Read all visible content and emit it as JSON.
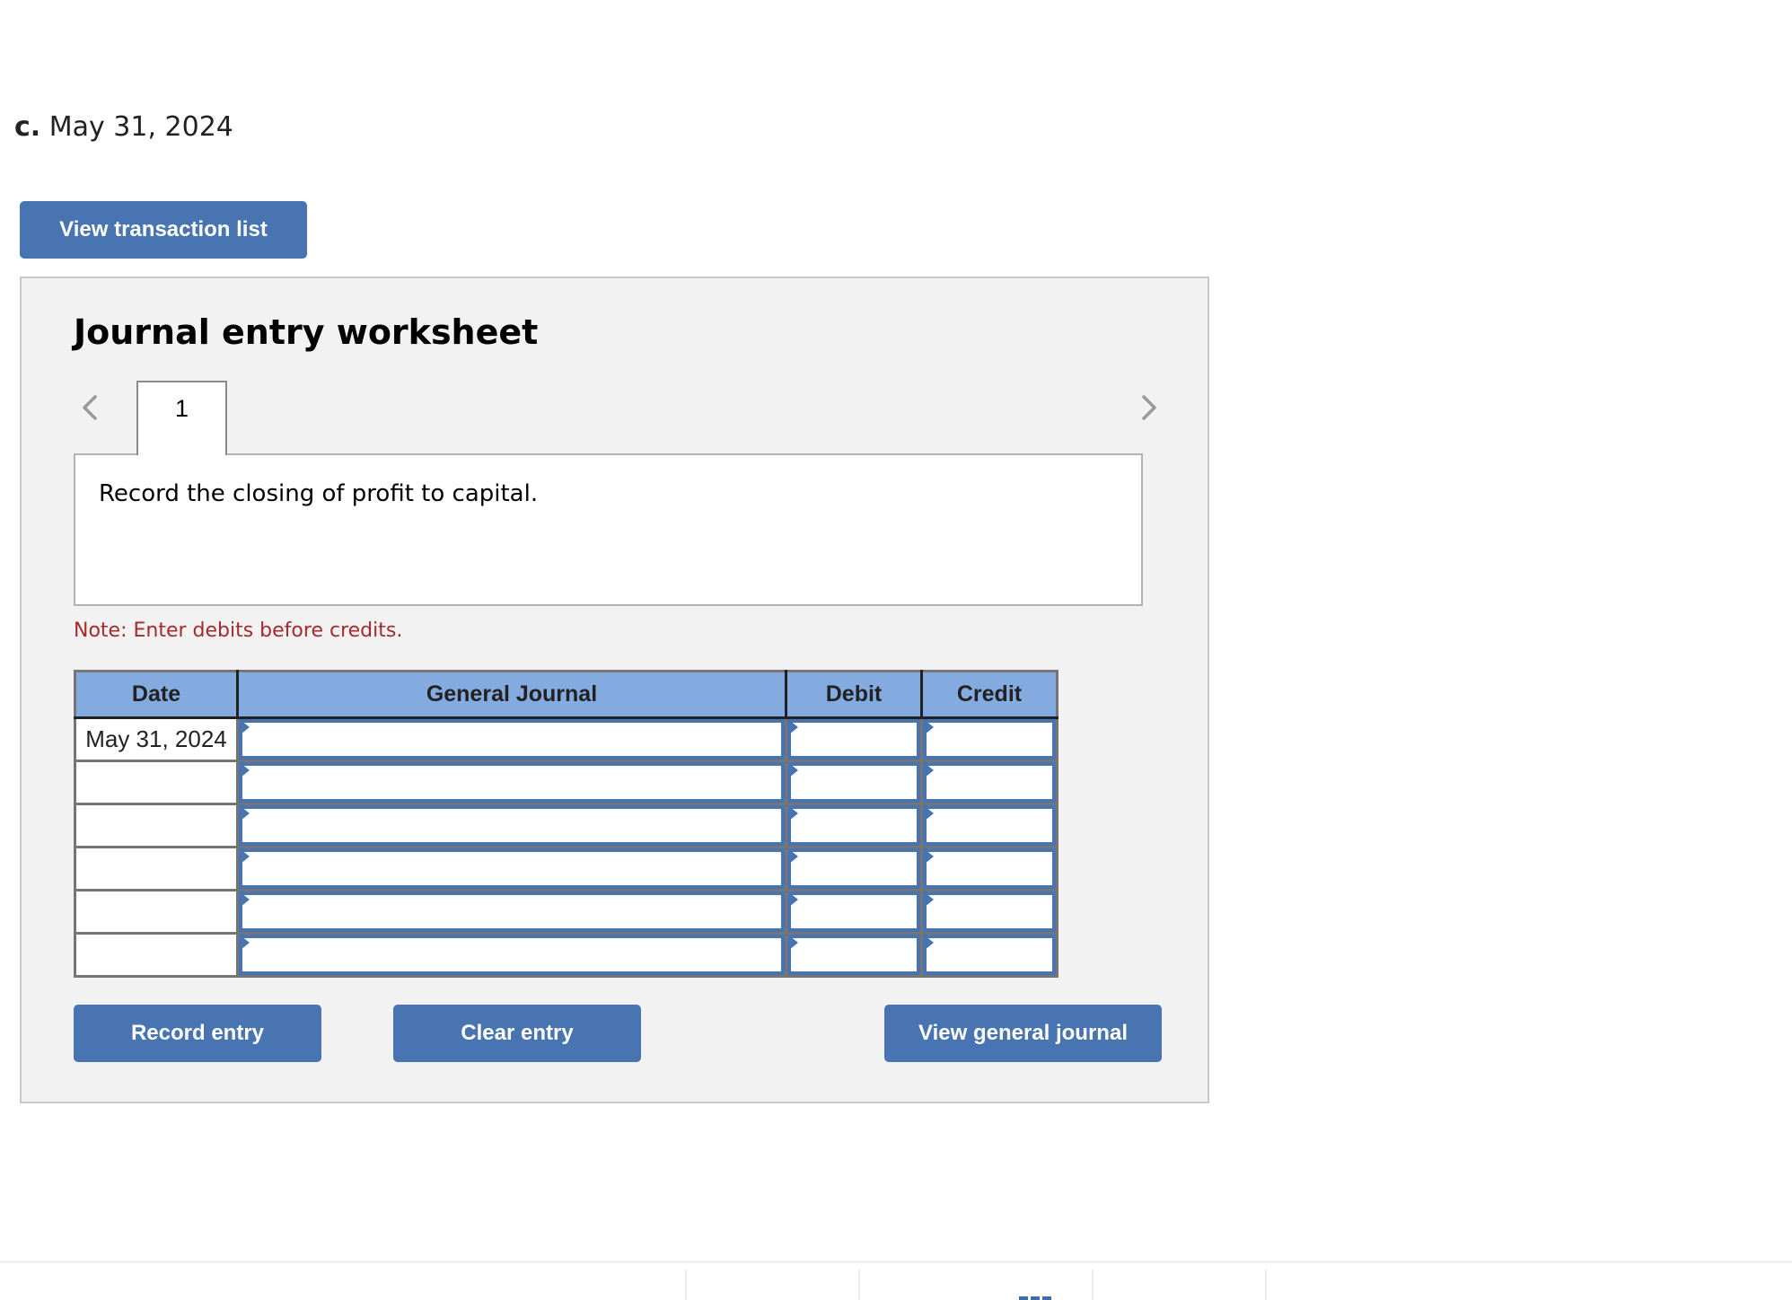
{
  "part": {
    "letter": "c.",
    "date": "May 31, 2024"
  },
  "buttons": {
    "view_transactions": "View transaction list",
    "record_entry": "Record entry",
    "clear_entry": "Clear entry",
    "view_general_journal": "View general journal"
  },
  "worksheet": {
    "title": "Journal entry worksheet",
    "tabs": [
      {
        "label": "1",
        "active": true
      }
    ],
    "nav": {
      "prev_icon": "chevron-left-icon",
      "next_icon": "chevron-right-icon"
    },
    "description": "Record the closing of profit to capital.",
    "note": "Note: Enter debits before credits."
  },
  "journal": {
    "columns": [
      "Date",
      "General Journal",
      "Debit",
      "Credit"
    ],
    "rows": [
      {
        "date": "May 31, 2024",
        "account": "",
        "debit": "",
        "credit": ""
      },
      {
        "date": "",
        "account": "",
        "debit": "",
        "credit": ""
      },
      {
        "date": "",
        "account": "",
        "debit": "",
        "credit": ""
      },
      {
        "date": "",
        "account": "",
        "debit": "",
        "credit": ""
      },
      {
        "date": "",
        "account": "",
        "debit": "",
        "credit": ""
      },
      {
        "date": "",
        "account": "",
        "debit": "",
        "credit": ""
      }
    ]
  },
  "colors": {
    "button_blue": "#4874b2",
    "header_blue": "#84abe0",
    "note_red": "#a52a2a",
    "panel_bg": "#f2f2f2"
  }
}
